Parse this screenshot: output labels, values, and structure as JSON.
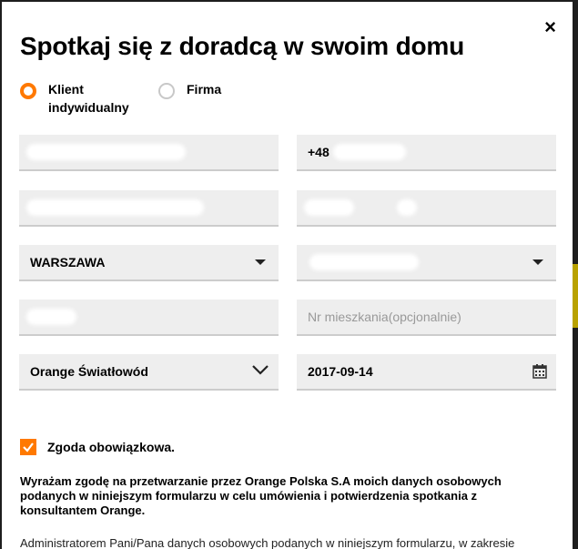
{
  "modal": {
    "title": "Spotkaj się z doradcą w swoim domu",
    "close_symbol": "×"
  },
  "customer_type": {
    "options": [
      {
        "label_line1": "Klient",
        "label_line2": "indywidualny",
        "selected": true
      },
      {
        "label_line1": "Firma",
        "label_line2": "",
        "selected": false
      }
    ]
  },
  "form": {
    "phone_prefix": "+48",
    "city": "WARSZAWA",
    "apartment_placeholder": "Nr mieszkania(opcjonalnie)",
    "service": "Orange Światłowód",
    "date": "2017-09-14"
  },
  "consent": {
    "label": "Zgoda obowiązkowa.",
    "checked": true,
    "text": "Wyrażam zgodę na przetwarzanie przez Orange Polska S.A moich danych osobowych podanych w niniejszym formularzu w celu umówienia i potwierdzenia spotkania z konsultantem Orange.",
    "admin_text": "Administratorem Pani/Pana danych osobowych podanych w niniejszym formularzu, w zakresie"
  },
  "colors": {
    "accent": "#ff7900",
    "field_bg": "#eeeeee"
  }
}
